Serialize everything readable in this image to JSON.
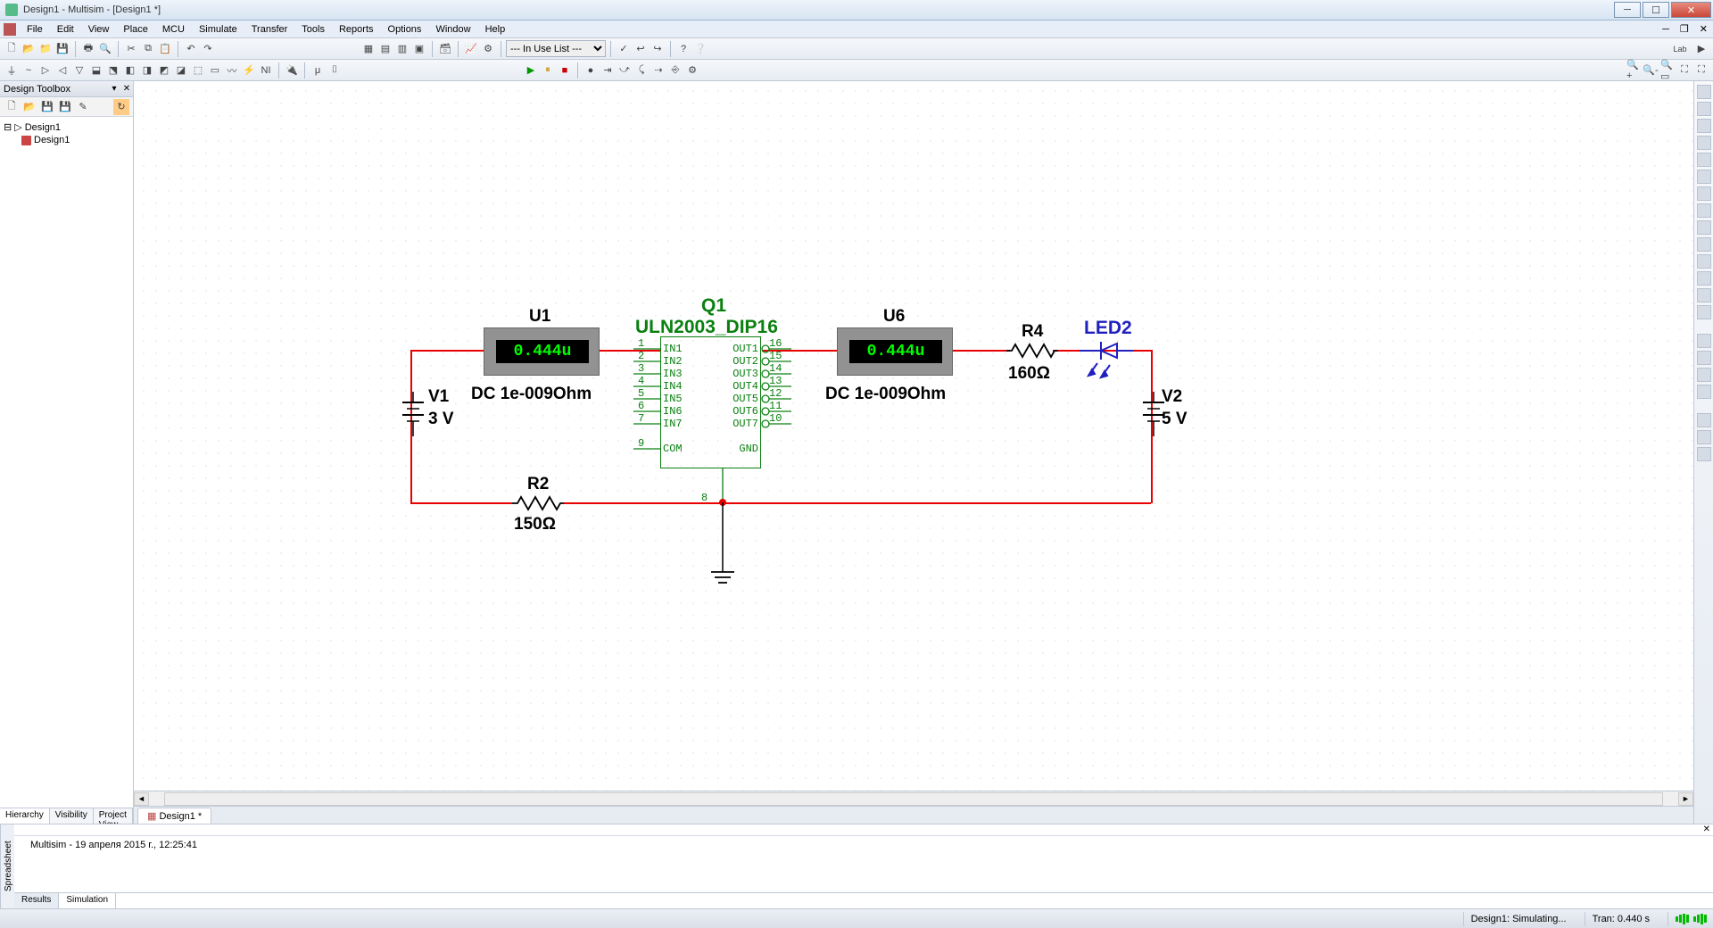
{
  "window": {
    "title": "Design1 - Multisim - [Design1 *]"
  },
  "menu": [
    "File",
    "Edit",
    "View",
    "Place",
    "MCU",
    "Simulate",
    "Transfer",
    "Tools",
    "Reports",
    "Options",
    "Window",
    "Help"
  ],
  "inuse": "--- In Use List ---",
  "toolbox": {
    "title": "Design Toolbox",
    "root": "Design1",
    "doc": "Design1",
    "tabs": [
      "Hierarchy",
      "Visibility",
      "Project View"
    ],
    "active_tab": 0,
    "side_label": "Spreadsheet"
  },
  "doctab": "Design1 *",
  "output": {
    "message": "Multisim  -  19 апреля 2015 г., 12:25:41",
    "tabs": [
      "Results",
      "Simulation"
    ],
    "active_tab": 1
  },
  "status": {
    "sim": "Design1: Simulating...",
    "tran": "Tran: 0.440 s"
  },
  "circuit": {
    "U1": {
      "name": "U1",
      "dc": "DC  1e-009Ohm",
      "value": "0.444u"
    },
    "U6": {
      "name": "U6",
      "dc": "DC  1e-009Ohm",
      "value": "0.444u"
    },
    "Q1": {
      "name": "Q1",
      "type": "ULN2003_DIP16",
      "left": [
        "IN1",
        "IN2",
        "IN3",
        "IN4",
        "IN5",
        "IN6",
        "IN7",
        "",
        "COM"
      ],
      "right": [
        "OUT1",
        "OUT2",
        "OUT3",
        "OUT4",
        "OUT5",
        "OUT6",
        "OUT7",
        "",
        "GND"
      ],
      "lpins": [
        "1",
        "2",
        "3",
        "4",
        "5",
        "6",
        "7",
        "",
        "9"
      ],
      "rpins": [
        "16",
        "15",
        "14",
        "13",
        "12",
        "11",
        "10",
        "",
        "8"
      ]
    },
    "V1": {
      "name": "V1",
      "value": "3 V"
    },
    "V2": {
      "name": "V2",
      "value": "5 V"
    },
    "R2": {
      "name": "R2",
      "value": "150Ω"
    },
    "R4": {
      "name": "R4",
      "value": "160Ω"
    },
    "LED2": {
      "name": "LED2"
    }
  }
}
